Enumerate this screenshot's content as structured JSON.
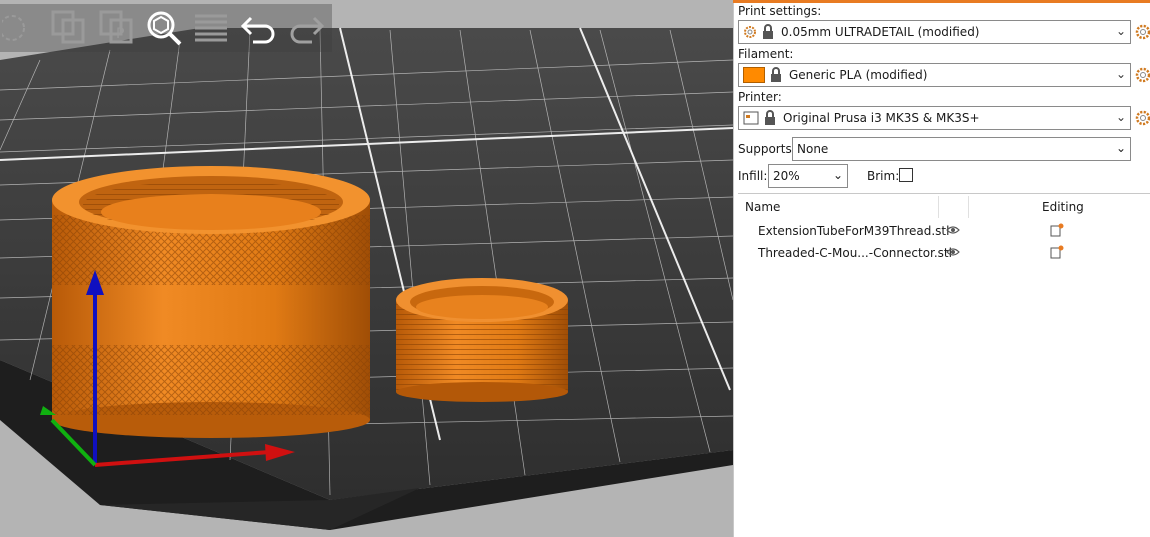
{
  "print_settings": {
    "label": "Print settings:",
    "value": "0.05mm ULTRADETAIL (modified)"
  },
  "filament": {
    "label": "Filament:",
    "value": "Generic PLA (modified)",
    "color": "#ff8a00"
  },
  "printer": {
    "label": "Printer:",
    "value": "Original Prusa i3 MK3S & MK3S+"
  },
  "supports": {
    "label": "Supports:",
    "value": "None"
  },
  "infill": {
    "label": "Infill:",
    "value": "20%"
  },
  "brim": {
    "label": "Brim:",
    "checked": false
  },
  "object_list": {
    "headers": [
      "Name",
      "Editing"
    ],
    "items": [
      {
        "name": "ExtensionTubeForM39Thread.stl"
      },
      {
        "name": "Threaded-C-Mou...-Connector.stl"
      }
    ]
  },
  "toolbar": {
    "icons": [
      "arrange-icon",
      "copy-icon",
      "paste-icon",
      "search-icon",
      "layers-icon",
      "undo-icon",
      "redo-icon"
    ]
  },
  "colors": {
    "accent": "#e87b22",
    "model": "#e07a1a",
    "bed": "#3a3a3a",
    "axis_x": "#d01010",
    "axis_y": "#10b010",
    "axis_z": "#1010c0"
  }
}
